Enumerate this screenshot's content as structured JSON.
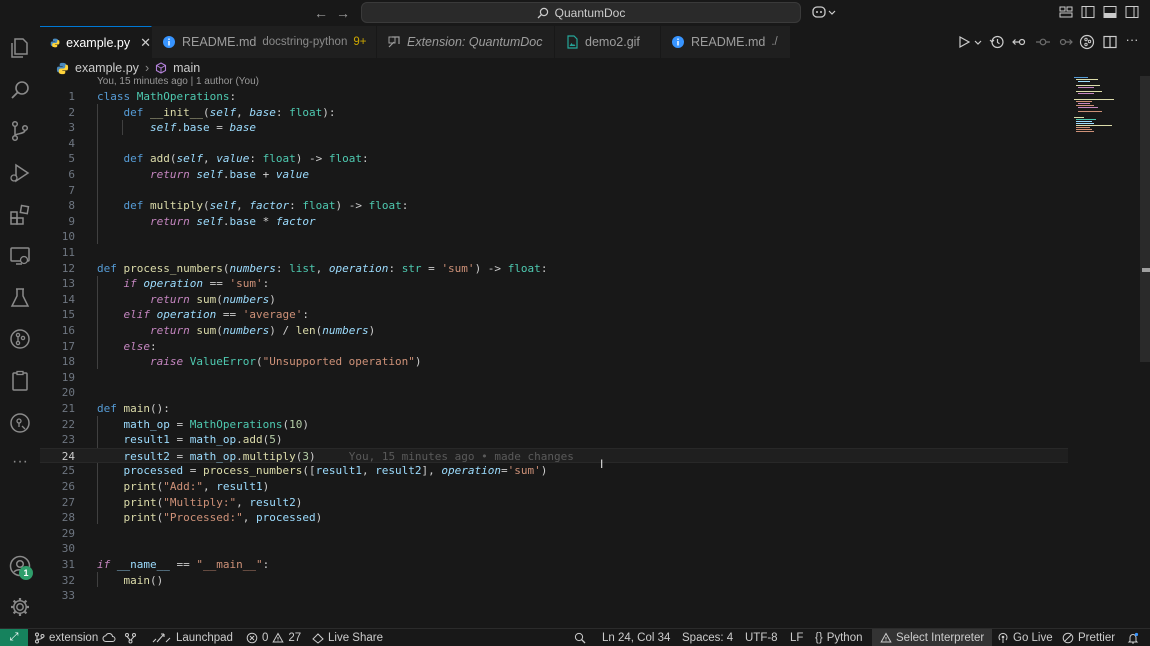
{
  "title_bar": {
    "search_text": "QuantumDoc",
    "back_icon": "arrow-left-icon",
    "forward_icon": "arrow-right-icon"
  },
  "tabs": [
    {
      "label": "example.py",
      "subtitle": "",
      "badge": "",
      "icon": "python-file-icon",
      "active": true
    },
    {
      "label": "README.md",
      "subtitle": "docstring-python",
      "badge": "9+",
      "icon": "info-icon",
      "active": false
    },
    {
      "label": "Extension: QuantumDoc",
      "subtitle": "",
      "badge": "",
      "icon": "extension-preview-icon",
      "active": false
    },
    {
      "label": "demo2.gif",
      "subtitle": "",
      "badge": "",
      "icon": "image-file-icon",
      "active": false
    },
    {
      "label": "README.md",
      "subtitle": "./",
      "badge": "",
      "icon": "info-icon",
      "active": false
    }
  ],
  "breadcrumb": {
    "file": "example.py",
    "symbol": "main"
  },
  "editor": {
    "codelens": "You, 15 minutes ago | 1 author (You)",
    "inline_blame": "You, 15 minutes ago • made changes",
    "current_line": 24
  },
  "status_bar": {
    "branch": "extension",
    "launchpad": "Launchpad",
    "errors": "0",
    "warnings": "27",
    "live_share": "Live Share",
    "position": "Ln 24, Col 34",
    "spaces": "Spaces: 4",
    "encoding": "UTF-8",
    "eol": "LF",
    "language": "Python",
    "interpreter": "Select Interpreter",
    "go_live": "Go Live",
    "prettier": "Prettier"
  },
  "activity_bar": {
    "accounts_badge": "1"
  },
  "colors": {
    "accent": "#0078d4",
    "remote": "#16825d",
    "badge": "#2f9e6b"
  }
}
